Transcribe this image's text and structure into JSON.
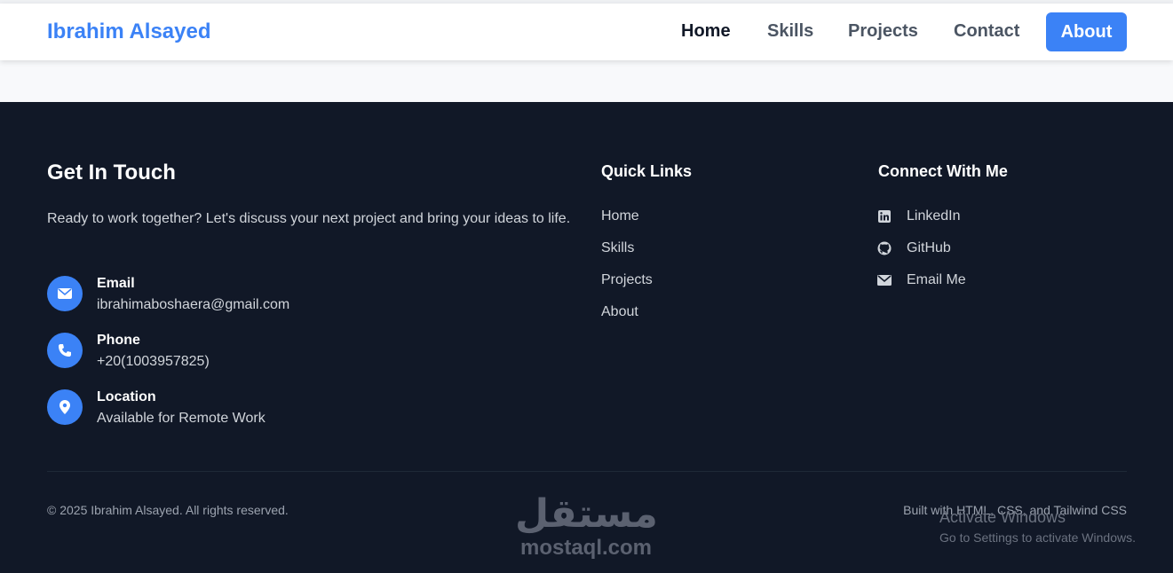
{
  "nav": {
    "brand": "Ibrahim Alsayed",
    "links": [
      {
        "label": "Home"
      },
      {
        "label": "Skills"
      },
      {
        "label": "Projects"
      },
      {
        "label": "Contact"
      }
    ],
    "cta": "About"
  },
  "footer": {
    "get_in_touch": {
      "title": "Get In Touch",
      "intro": "Ready to work together? Let's discuss your next project and bring your ideas to life.",
      "items": [
        {
          "label": "Email",
          "value": "ibrahimaboshaera@gmail.com",
          "icon": "envelope-icon"
        },
        {
          "label": "Phone",
          "value": "+20(1003957825)",
          "icon": "phone-icon"
        },
        {
          "label": "Location",
          "value": "Available for Remote Work",
          "icon": "map-pin-icon"
        }
      ]
    },
    "quick_links": {
      "title": "Quick Links",
      "items": [
        "Home",
        "Skills",
        "Projects",
        "About"
      ]
    },
    "connect": {
      "title": "Connect With Me",
      "items": [
        {
          "label": "LinkedIn",
          "icon": "linkedin-icon"
        },
        {
          "label": "GitHub",
          "icon": "github-icon"
        },
        {
          "label": "Email Me",
          "icon": "envelope-icon"
        }
      ]
    },
    "copyright": "© 2025 Ibrahim Alsayed. All rights reserved.",
    "built_with": "Built with HTML, CSS, and Tailwind CSS"
  },
  "overlays": {
    "watermark_arabic": "مستقل",
    "watermark_latin": "mostaql.com",
    "activate_title": "Activate Windows",
    "activate_sub": "Go to Settings to activate Windows."
  },
  "colors": {
    "accent": "#3b82f6",
    "footer_bg": "#111827",
    "nav_bg": "#ffffff",
    "page_bg": "#f8f9fb"
  }
}
